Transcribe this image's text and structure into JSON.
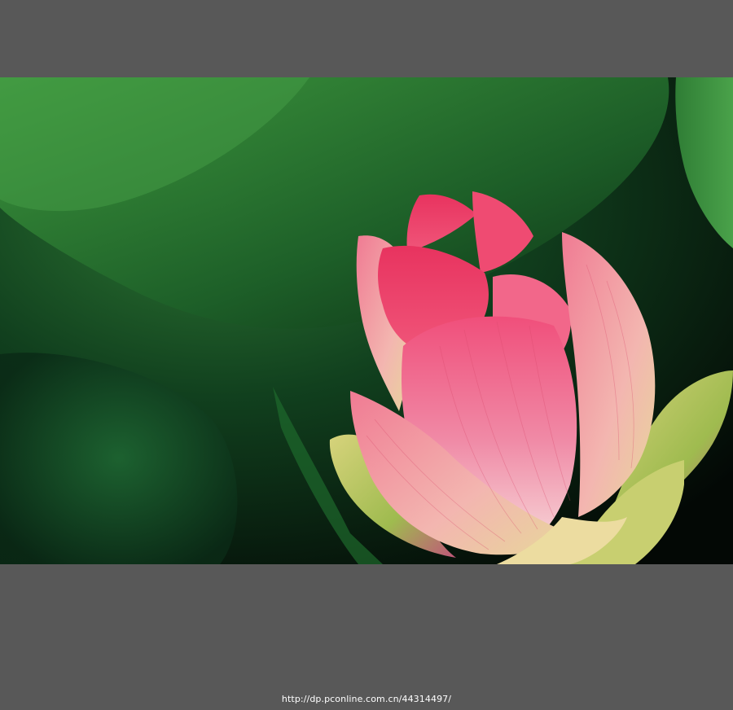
{
  "caption": {
    "url_text": "http://dp.pconline.com.cn/44314497/"
  },
  "photo": {
    "subject": "pink lotus bud",
    "colors": {
      "frame": "#585858",
      "leaf_light": "#3c8a3a",
      "leaf_dark": "#0f3a1a",
      "petal_pink": "#e8527a",
      "petal_pale": "#f2b8c4",
      "sepal_green": "#b8c860"
    }
  }
}
